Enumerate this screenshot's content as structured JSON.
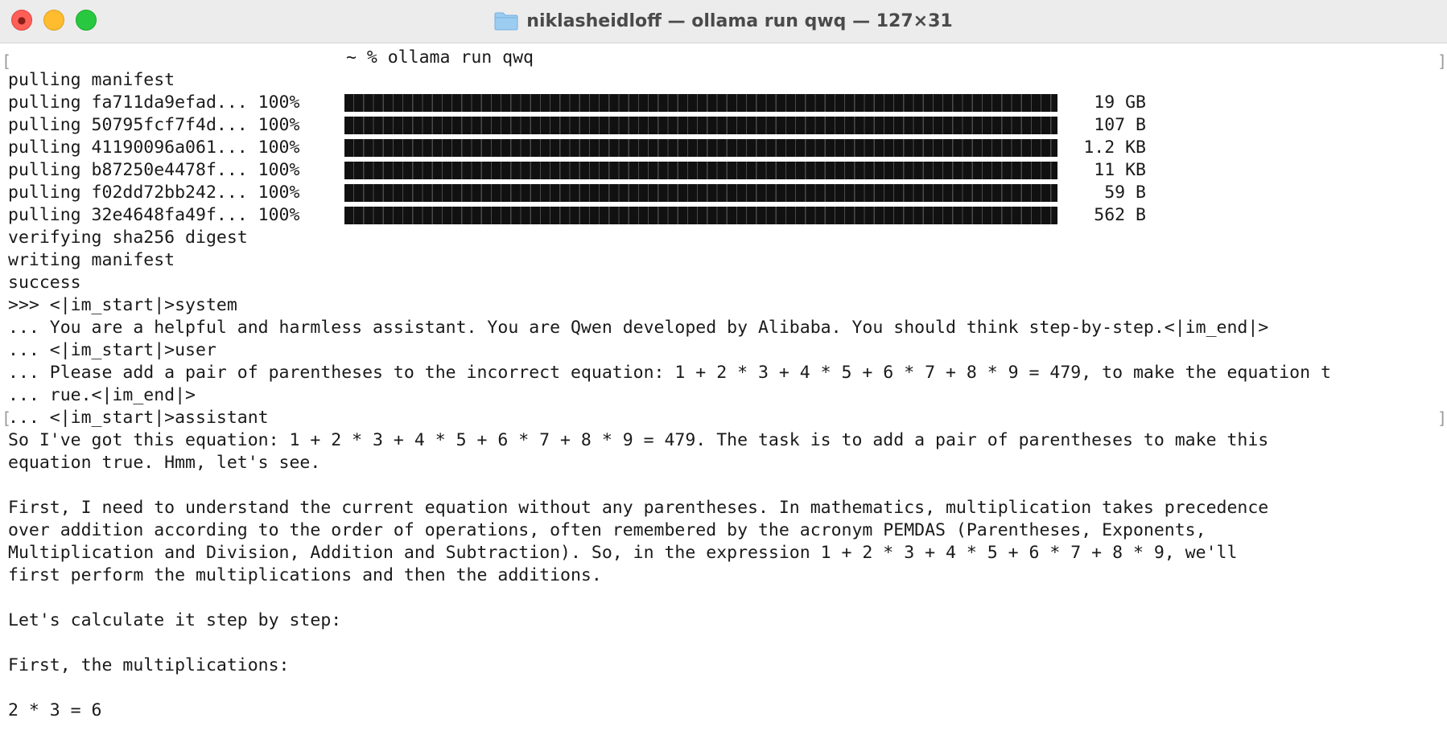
{
  "window": {
    "title": "niklasheidloff — ollama run qwq — 127×31",
    "folder_icon": "folder-icon",
    "close_icon": "close-icon",
    "minimize_icon": "minimize-icon",
    "zoom_icon": "zoom-icon"
  },
  "terminal": {
    "prompt": {
      "command": "~ % ollama run qwq"
    },
    "pull_header": "pulling manifest",
    "layers": [
      {
        "label": "pulling fa711da9efad... 100%",
        "progress_percent": 100,
        "size": "19 GB"
      },
      {
        "label": "pulling 50795fcf7f4d... 100%",
        "progress_percent": 100,
        "size": "107 B"
      },
      {
        "label": "pulling 41190096a061... 100%",
        "progress_percent": 100,
        "size": "1.2 KB"
      },
      {
        "label": "pulling b87250e4478f... 100%",
        "progress_percent": 100,
        "size": "11 KB"
      },
      {
        "label": "pulling f02dd72bb242... 100%",
        "progress_percent": 100,
        "size": "59 B"
      },
      {
        "label": "pulling 32e4648fa49f... 100%",
        "progress_percent": 100,
        "size": "562 B"
      }
    ],
    "status_lines": [
      "verifying sha256 digest",
      "writing manifest",
      "success"
    ],
    "input_lines": [
      ">>> <|im_start|>system",
      "... You are a helpful and harmless assistant. You are Qwen developed by Alibaba. You should think step-by-step.<|im_end|>",
      "... <|im_start|>user",
      "... Please add a pair of parentheses to the incorrect equation: 1 + 2 * 3 + 4 * 5 + 6 * 7 + 8 * 9 = 479, to make the equation t",
      "... rue.<|im_end|>",
      "... <|im_start|>assistant"
    ],
    "output_lines": [
      "So I've got this equation: 1 + 2 * 3 + 4 * 5 + 6 * 7 + 8 * 9 = 479. The task is to add a pair of parentheses to make this",
      "equation true. Hmm, let's see.",
      "",
      "First, I need to understand the current equation without any parentheses. In mathematics, multiplication takes precedence",
      "over addition according to the order of operations, often remembered by the acronym PEMDAS (Parentheses, Exponents,",
      "Multiplication and Division, Addition and Subtraction). So, in the expression 1 + 2 * 3 + 4 * 5 + 6 * 7 + 8 * 9, we'll",
      "first perform the multiplications and then the additions.",
      "",
      "Let's calculate it step by step:",
      "",
      "First, the multiplications:",
      "",
      "2 * 3 = 6"
    ]
  }
}
